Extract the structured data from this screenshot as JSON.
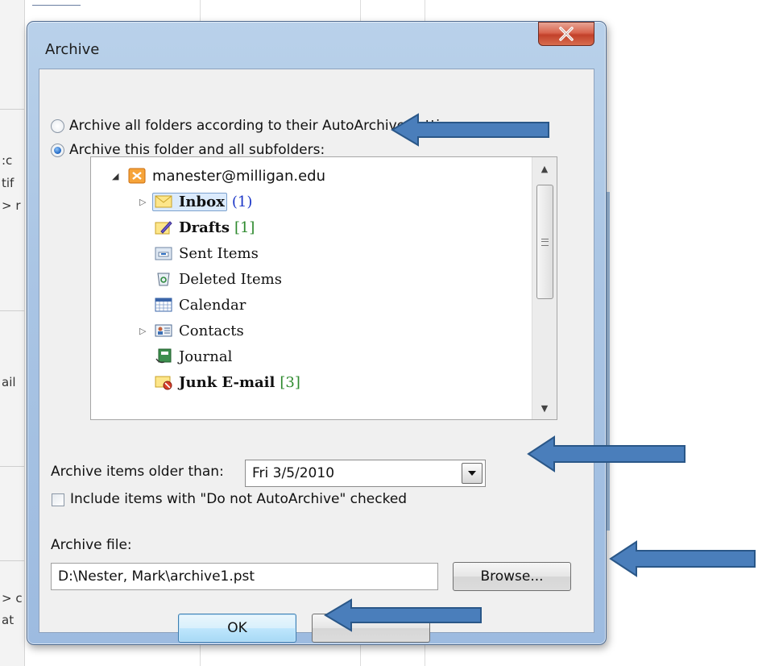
{
  "background": {
    "top_link": "",
    "left_fragments": [
      ":c",
      "tif",
      "> r",
      "ail",
      "> c",
      "at"
    ]
  },
  "dialog": {
    "title": "Archive",
    "close_glyph": "X",
    "radio_all": "Archive all folders according to their AutoArchive settings",
    "radio_this": "Archive this folder and all subfolders:",
    "tree": [
      {
        "label": "manester@milligan.edu",
        "icon": "exchange-account-icon"
      },
      {
        "label": "Inbox",
        "count": "(1)",
        "icon": "inbox-icon"
      },
      {
        "label": "Drafts",
        "count": "[1]",
        "icon": "drafts-icon"
      },
      {
        "label": "Sent Items",
        "count": "",
        "icon": "sent-items-icon"
      },
      {
        "label": "Deleted Items",
        "count": "",
        "icon": "deleted-items-icon"
      },
      {
        "label": "Calendar",
        "count": "",
        "icon": "calendar-icon"
      },
      {
        "label": "Contacts",
        "count": "",
        "icon": "contacts-icon"
      },
      {
        "label": "Journal",
        "count": "",
        "icon": "journal-icon"
      },
      {
        "label": "Junk E-mail",
        "count": "[3]",
        "icon": "junk-email-icon"
      }
    ],
    "older_than_label": "Archive items older than:",
    "older_than_value": "Fri 3/5/2010",
    "include_label": "Include items with \"Do not AutoArchive\" checked",
    "archive_file_label": "Archive file:",
    "archive_file_value": "D:\\Nester, Mark\\archive1.pst",
    "browse_label": "Browse...",
    "ok_label": "OK",
    "cancel_label": ""
  },
  "colors": {
    "arrow_fill": "#4a7ebb",
    "arrow_stroke": "#2a5788",
    "frame": "#aac5e4"
  }
}
